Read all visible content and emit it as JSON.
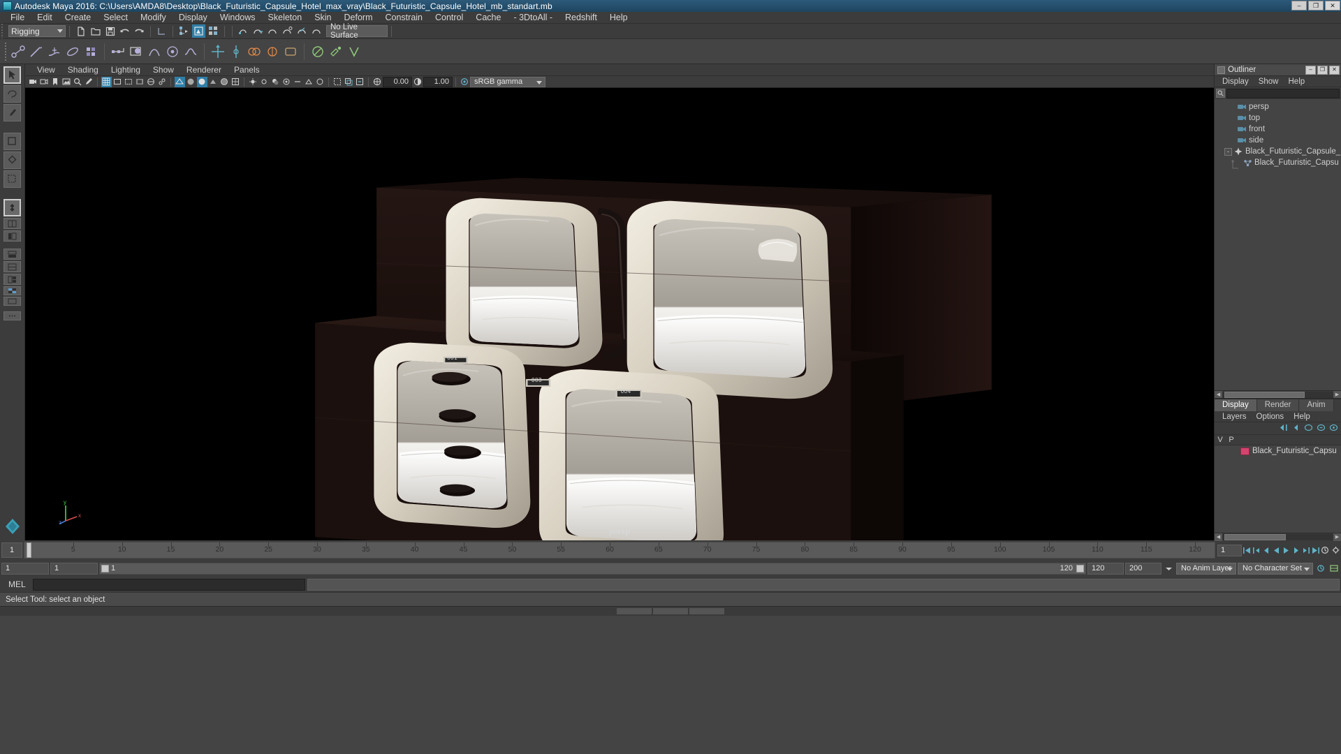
{
  "window": {
    "title": "Autodesk Maya 2016: C:\\Users\\AMDA8\\Desktop\\Black_Futuristic_Capsule_Hotel_max_vray\\Black_Futuristic_Capsule_Hotel_mb_standart.mb",
    "minimize": "–",
    "maximize": "❐",
    "close": "✕"
  },
  "menubar": {
    "items": [
      {
        "label": "File"
      },
      {
        "label": "Edit"
      },
      {
        "label": "Create"
      },
      {
        "label": "Select"
      },
      {
        "label": "Modify"
      },
      {
        "label": "Display"
      },
      {
        "label": "Windows"
      },
      {
        "label": "Skeleton"
      },
      {
        "label": "Skin"
      },
      {
        "label": "Deform"
      },
      {
        "label": "Constrain"
      },
      {
        "label": "Control"
      },
      {
        "label": "Cache"
      },
      {
        "label": "- 3DtoAll -"
      },
      {
        "label": "Redshift"
      },
      {
        "label": "Help"
      }
    ]
  },
  "toolbar": {
    "menuset": "Rigging",
    "live_surface": "No Live Surface"
  },
  "viewport": {
    "menus": [
      {
        "label": "View"
      },
      {
        "label": "Shading"
      },
      {
        "label": "Lighting"
      },
      {
        "label": "Show"
      },
      {
        "label": "Renderer"
      },
      {
        "label": "Panels"
      }
    ],
    "exposure": "0.00",
    "gamma": "1.00",
    "color_space": "sRGB gamma",
    "camera_label": "persp",
    "axis_labels": {
      "y": "y",
      "x": "x",
      "z": "z"
    },
    "capsule_tags": [
      "001",
      "003",
      "004"
    ]
  },
  "outliner": {
    "title": "Outliner",
    "menus": [
      {
        "label": "Display"
      },
      {
        "label": "Show"
      },
      {
        "label": "Help"
      }
    ],
    "search_value": "",
    "nodes": [
      {
        "label": "persp",
        "icon": "camera-icon",
        "indent": 1,
        "expand": ""
      },
      {
        "label": "top",
        "icon": "camera-icon",
        "indent": 1,
        "expand": ""
      },
      {
        "label": "front",
        "icon": "camera-icon",
        "indent": 1,
        "expand": ""
      },
      {
        "label": "side",
        "icon": "camera-icon",
        "indent": 1,
        "expand": ""
      },
      {
        "label": "Black_Futuristic_Capsule_I",
        "icon": "transform-icon",
        "indent": 0,
        "expand": "-"
      },
      {
        "label": "Black_Futuristic_Capsu",
        "icon": "mesh-icon",
        "indent": 1,
        "expand": ""
      }
    ]
  },
  "layer_editor": {
    "tabs": [
      {
        "label": "Display",
        "active": true
      },
      {
        "label": "Render",
        "active": false
      },
      {
        "label": "Anim",
        "active": false
      }
    ],
    "menus": [
      {
        "label": "Layers"
      },
      {
        "label": "Options"
      },
      {
        "label": "Help"
      }
    ],
    "columns": [
      "V",
      "P"
    ],
    "rows": [
      {
        "v": "",
        "p": "",
        "name": "Black_Futuristic_Capsu",
        "color": "#d6436e"
      }
    ]
  },
  "timeline": {
    "current_frame": "1",
    "ticks": [
      5,
      10,
      15,
      20,
      25,
      30,
      35,
      40,
      45,
      50,
      55,
      60,
      65,
      70,
      75,
      80,
      85,
      90,
      95,
      100,
      105,
      110,
      115,
      120
    ],
    "playhead_frame": 1,
    "range_start": "1",
    "range_end": "1",
    "range_bar_start": "1",
    "range_bar_end": "120",
    "anim_start": "120",
    "anim_end": "200",
    "frame_field": "1",
    "anim_layer": "No Anim Layer",
    "character_set": "No Character Set"
  },
  "command_line": {
    "label": "MEL",
    "input_value": "",
    "output_value": ""
  },
  "status": {
    "message": "Select Tool: select an object"
  },
  "colors": {
    "accent": "#2f7fa8",
    "panel_bg": "#3c3c3c",
    "field_bg": "#2b2b2b",
    "layer_swatch": "#d6436e"
  }
}
